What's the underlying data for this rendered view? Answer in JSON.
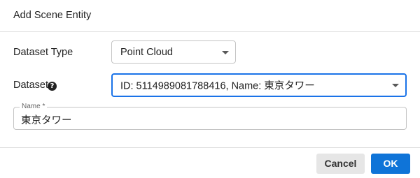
{
  "dialog": {
    "title": "Add Scene Entity"
  },
  "dataset_type": {
    "label": "Dataset Type",
    "value": "Point Cloud"
  },
  "dataset": {
    "label": "Dataset",
    "help_icon": "question-circle-icon",
    "help_glyph": "?",
    "value": "ID: 5114989081788416, Name: 東京タワー"
  },
  "name_field": {
    "label": "Name *",
    "value": "東京タワー"
  },
  "footer": {
    "cancel_label": "Cancel",
    "ok_label": "OK"
  },
  "colors": {
    "accent": "#0f74d8",
    "focus_border": "#1a73e8",
    "cancel_bg": "#e6e6e6"
  }
}
